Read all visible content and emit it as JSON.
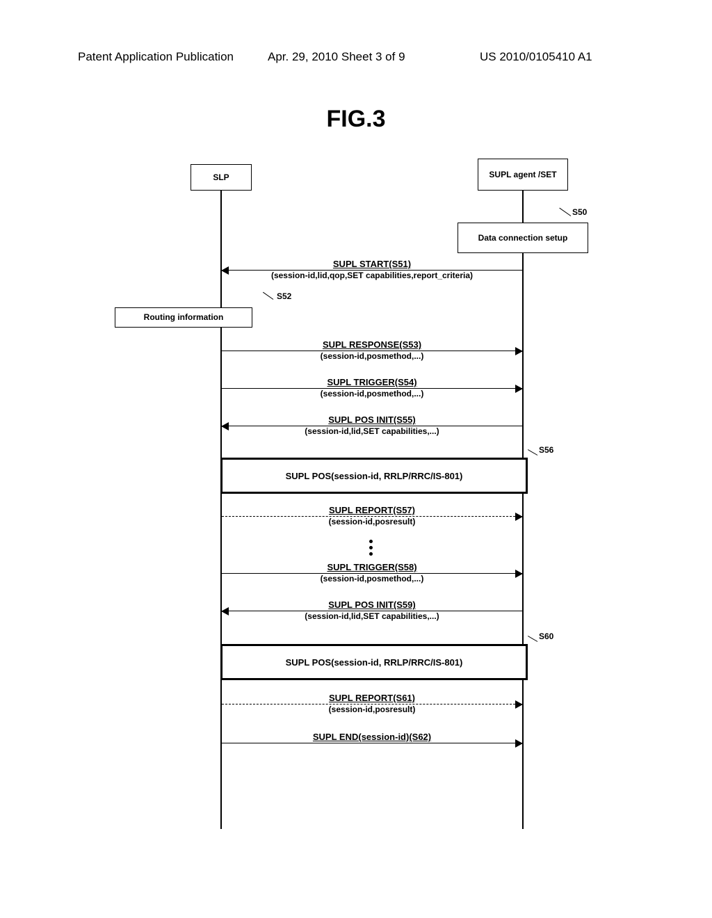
{
  "header": {
    "left": "Patent Application Publication",
    "mid": "Apr. 29, 2010  Sheet 3 of 9",
    "right": "US 2010/0105410 A1"
  },
  "figure_title": "FIG.3",
  "actors": {
    "slp": "SLP",
    "set": "SUPL agent /SET"
  },
  "side_boxes": {
    "data_connection": "Data connection setup",
    "routing_info": "Routing information"
  },
  "tags": {
    "s50": "S50",
    "s52": "S52",
    "s56": "S56",
    "s60": "S60"
  },
  "messages": {
    "s51": {
      "title": "SUPL START(S51)",
      "params": "(session-id,lid,qop,SET capabilities,report_criteria)"
    },
    "s53": {
      "title": "SUPL RESPONSE(S53)",
      "params": "(session-id,posmethod,...)"
    },
    "s54": {
      "title": "SUPL TRIGGER(S54)",
      "params": "(session-id,posmethod,...)"
    },
    "s55": {
      "title": "SUPL POS INIT(S55)",
      "params": "(session-id,lid,SET capabilities,...)"
    },
    "pos56": "SUPL POS(session-id, RRLP/RRC/IS-801)",
    "s57": {
      "title": "SUPL REPORT(S57)",
      "params": "(session-id,posresult)"
    },
    "s58": {
      "title": "SUPL TRIGGER(S58)",
      "params": "(session-id,posmethod,...)"
    },
    "s59": {
      "title": "SUPL POS INIT(S59)",
      "params": "(session-id,lid,SET capabilities,...)"
    },
    "pos60": "SUPL POS(session-id, RRLP/RRC/IS-801)",
    "s61": {
      "title": "SUPL REPORT(S61)",
      "params": "(session-id,posresult)"
    },
    "s62": {
      "title": "SUPL END(session-id)(S62)"
    }
  }
}
